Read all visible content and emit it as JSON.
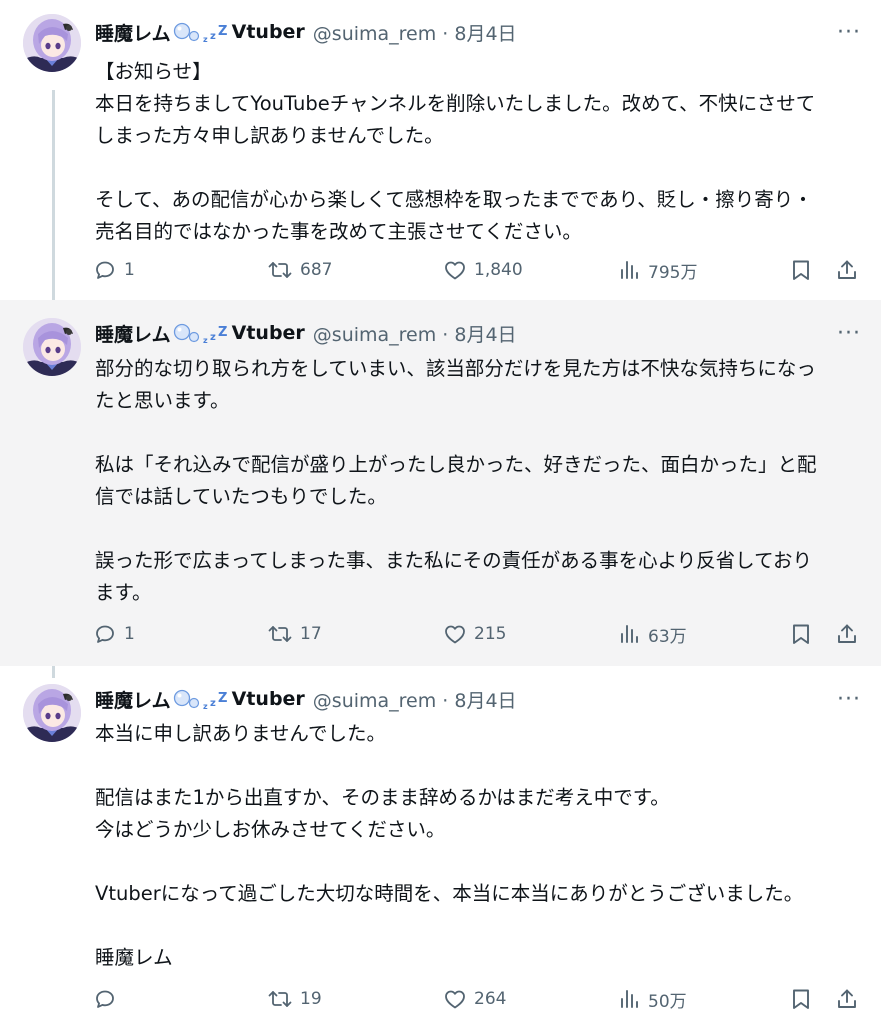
{
  "tweets": [
    {
      "name": "睡魔レム",
      "name_suffix": "Vtuber",
      "name_deco_icon": "bubbles-zzz-icon",
      "handle": "@suima_rem · 8月4日",
      "more_label": "···",
      "paragraphs": [
        [
          "【お知らせ】",
          "本日を持ちましてYouTubeチャンネルを削除いたしました。改めて、不快にさせて",
          "しまった方々申し訳ありませんでした。"
        ],
        [
          "そして、あの配信が心から楽しくて感想枠を取ったまでであり、貶し・擦り寄り・",
          "売名目的ではなかった事を改めて主張させてください。"
        ]
      ],
      "stats": {
        "replies": "1",
        "retweets": "687",
        "likes": "1,840",
        "views": "795万"
      }
    },
    {
      "name": "睡魔レム",
      "name_suffix": "Vtuber",
      "name_deco_icon": "bubbles-zzz-icon",
      "handle": "@suima_rem · 8月4日",
      "more_label": "···",
      "paragraphs": [
        [
          "部分的な切り取られ方をしていまい、該当部分だけを見た方は不快な気持ちになっ",
          "たと思います。"
        ],
        [
          "私は「それ込みで配信が盛り上がったし良かった、好きだった、面白かった」と配",
          "信では話していたつもりでした。"
        ],
        [
          "誤った形で広まってしまった事、また私にその責任がある事を心より反省しており",
          "ます。"
        ]
      ],
      "stats": {
        "replies": "1",
        "retweets": "17",
        "likes": "215",
        "views": "63万"
      }
    },
    {
      "name": "睡魔レム",
      "name_suffix": "Vtuber",
      "name_deco_icon": "bubbles-zzz-icon",
      "handle": "@suima_rem · 8月4日",
      "more_label": "···",
      "paragraphs": [
        [
          "本当に申し訳ありませんでした。"
        ],
        [
          "配信はまた1から出直すか、そのまま辞めるかはまだ考え中です。",
          "今はどうか少しお休みさせてください。"
        ],
        [
          "Vtuberになって過ごした大切な時間を、本当に本当にありがとうございました。"
        ],
        [
          "睡魔レム"
        ]
      ],
      "stats": {
        "replies": "",
        "retweets": "19",
        "likes": "264",
        "views": "50万"
      }
    }
  ],
  "colors": {
    "text": "#0f1419",
    "secondary": "#536471",
    "highlight_bg": "#f4f4f5",
    "thread_line": "#cfd9de",
    "name_deco_blue": "#4a7fd6"
  }
}
